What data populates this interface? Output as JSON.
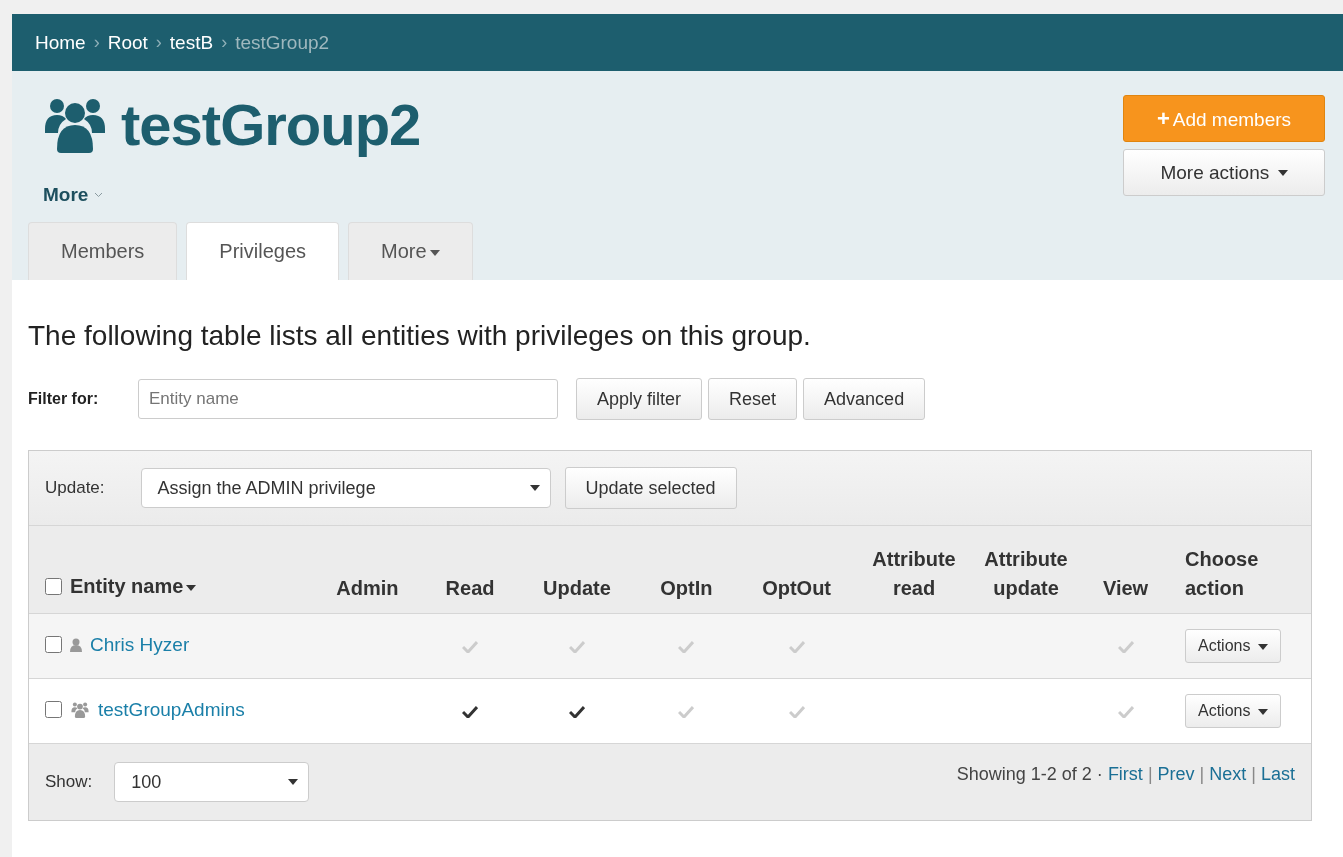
{
  "breadcrumb": [
    {
      "label": "Home",
      "current": false
    },
    {
      "label": "Root",
      "current": false
    },
    {
      "label": "testB",
      "current": false
    },
    {
      "label": "testGroup2",
      "current": true
    }
  ],
  "breadcrumb_separator": "›",
  "header": {
    "title": "testGroup2",
    "more_label": "More",
    "add_button": "Add members",
    "add_icon": "+",
    "more_actions": "More actions"
  },
  "tabs": [
    {
      "label": "Members",
      "selected": false,
      "dropdown": false
    },
    {
      "label": "Privileges",
      "selected": true,
      "dropdown": false
    },
    {
      "label": "More",
      "selected": false,
      "dropdown": true
    }
  ],
  "intro": "The following table lists all entities with privileges on this group.",
  "filter": {
    "label": "Filter for:",
    "placeholder": "Entity name",
    "buttons": [
      "Apply filter",
      "Reset",
      "Advanced"
    ]
  },
  "update": {
    "label": "Update:",
    "value": "Assign the ADMIN privilege",
    "button": "Update selected"
  },
  "table": {
    "columns": [
      {
        "label": "Entity name",
        "sortable": true
      },
      {
        "label": "Admin",
        "sortable": false
      },
      {
        "label": "Read",
        "sortable": false
      },
      {
        "label": "Update",
        "sortable": false
      },
      {
        "label": "OptIn",
        "sortable": false
      },
      {
        "label": "OptOut",
        "sortable": false
      },
      {
        "label": "Attribute read",
        "sortable": false
      },
      {
        "label": "Attribute update",
        "sortable": false
      },
      {
        "label": "View",
        "sortable": false
      },
      {
        "label": "Choose action",
        "sortable": false
      }
    ],
    "header_checked": false,
    "rows": [
      {
        "checked": false,
        "kind": "person",
        "name": "Chris Hyzer",
        "privileges": [
          {
            "kind": "none"
          },
          {
            "kind": "inherited"
          },
          {
            "kind": "inherited"
          },
          {
            "kind": "inherited"
          },
          {
            "kind": "inherited"
          },
          {
            "kind": "none"
          },
          {
            "kind": "none"
          },
          {
            "kind": "inherited"
          }
        ],
        "action": "Actions"
      },
      {
        "checked": false,
        "kind": "group",
        "name": "testGroupAdmins",
        "privileges": [
          {
            "kind": "none"
          },
          {
            "kind": "direct"
          },
          {
            "kind": "direct"
          },
          {
            "kind": "inherited"
          },
          {
            "kind": "inherited"
          },
          {
            "kind": "none"
          },
          {
            "kind": "none"
          },
          {
            "kind": "inherited"
          }
        ],
        "action": "Actions"
      }
    ]
  },
  "footer": {
    "show_label": "Show:",
    "show_value": "100",
    "summary": "Showing 1-2 of 2 ·",
    "pager": [
      {
        "kind": "link",
        "text": "First"
      },
      {
        "kind": "separator",
        "text": "|"
      },
      {
        "kind": "link",
        "text": "Prev"
      },
      {
        "kind": "separator",
        "text": "|"
      },
      {
        "kind": "link",
        "text": "Next"
      },
      {
        "kind": "separator",
        "text": "|"
      },
      {
        "kind": "link",
        "text": "Last"
      }
    ]
  }
}
